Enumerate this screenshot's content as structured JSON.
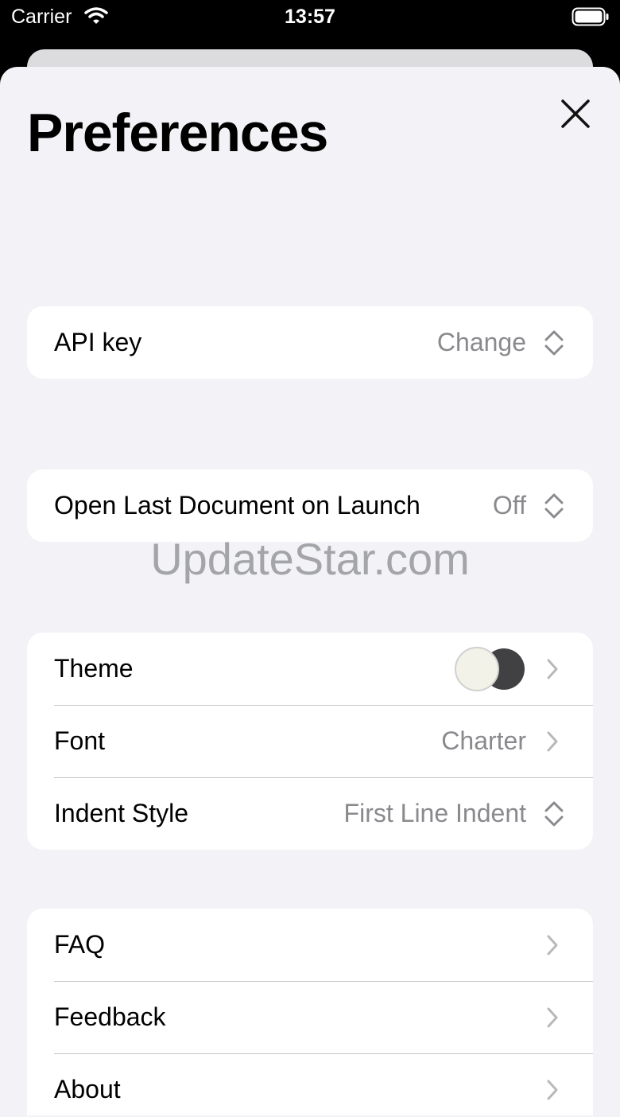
{
  "status_bar": {
    "carrier": "Carrier",
    "time": "13:57"
  },
  "title": "Preferences",
  "groups": {
    "api": {
      "label": "API key",
      "value": "Change"
    },
    "launch": {
      "label": "Open Last Document on Launch",
      "value": "Off"
    },
    "appearance": {
      "theme_label": "Theme",
      "font_label": "Font",
      "font_value": "Charter",
      "indent_label": "Indent Style",
      "indent_value": "First Line Indent"
    },
    "info": {
      "faq": "FAQ",
      "feedback": "Feedback",
      "about": "About"
    }
  },
  "watermark": "UpdateStar.com",
  "colors": {
    "accent_light": "#f3f2e8",
    "accent_dark": "#414143",
    "secondary_text": "#8a8a8e",
    "background": "#f2f2f7"
  }
}
